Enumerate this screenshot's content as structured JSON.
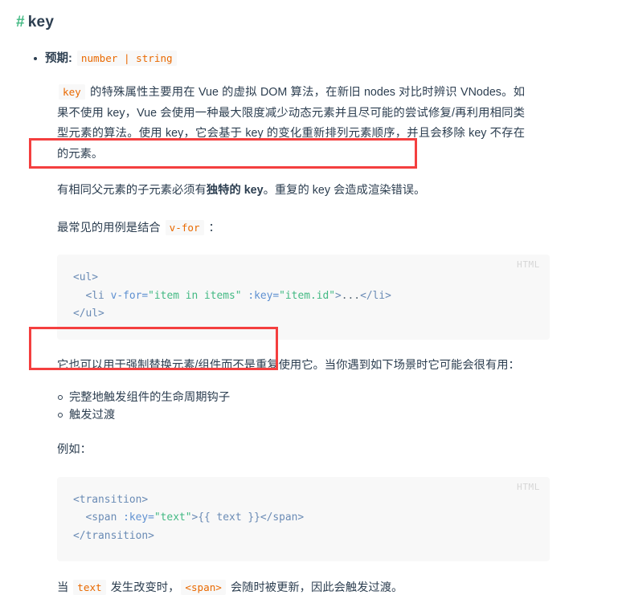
{
  "heading": {
    "anchor": "#",
    "title": "key"
  },
  "expects": {
    "label": "预期:",
    "types": "number | string"
  },
  "intro": {
    "code_key": "key",
    "text": " 的特殊属性主要用在 Vue 的虚拟 DOM 算法，在新旧 nodes 对比时辨识 VNodes。如果不使用 key，Vue 会使用一种最大限度减少动态元素并且尽可能的尝试修复/再利用相同类型元素的算法。使用 key，它会基于 key 的变化重新排列元素顺序，并且会移除 key 不存在的元素。"
  },
  "highlight_note": {
    "part1": "有相同父元素的子元素必须有",
    "bold": "独特的 key",
    "part2": "。重复的 key 会造成渲染错误。"
  },
  "usage_line": {
    "prefix": "最常见的用例是结合 ",
    "code": "v-for",
    "suffix": " ："
  },
  "code_block_1": {
    "lang": "HTML",
    "lines": [
      {
        "tokens": [
          {
            "t": "<ul>",
            "c": "tok-tag"
          }
        ]
      },
      {
        "tokens": [
          {
            "t": "  <li ",
            "c": "tok-tag"
          },
          {
            "t": "v-for=",
            "c": "tok-attr"
          },
          {
            "t": "\"item in items\"",
            "c": "tok-str"
          },
          {
            "t": " :key=",
            "c": "tok-attr"
          },
          {
            "t": "\"item.id\"",
            "c": "tok-str"
          },
          {
            "t": ">",
            "c": "tok-tag"
          },
          {
            "t": "...",
            "c": "tok-plain"
          },
          {
            "t": "</li>",
            "c": "tok-tag"
          }
        ]
      },
      {
        "tokens": [
          {
            "t": "</ul>",
            "c": "tok-tag"
          }
        ]
      }
    ]
  },
  "replace_note": "它也可以用于强制替换元素/组件而不是重复使用它。当你遇到如下场景时它可能会很有用：",
  "scenarios": [
    "完整地触发组件的生命周期钩子",
    "触发过渡"
  ],
  "example_label": "例如：",
  "code_block_2": {
    "lang": "HTML",
    "lines": [
      {
        "tokens": [
          {
            "t": "<transition>",
            "c": "tok-tag"
          }
        ]
      },
      {
        "tokens": [
          {
            "t": "  <span ",
            "c": "tok-tag"
          },
          {
            "t": ":key=",
            "c": "tok-attr"
          },
          {
            "t": "\"text\"",
            "c": "tok-str"
          },
          {
            "t": ">",
            "c": "tok-tag"
          },
          {
            "t": "{{ text }}",
            "c": "tok-punc"
          },
          {
            "t": "</span>",
            "c": "tok-tag"
          }
        ]
      },
      {
        "tokens": [
          {
            "t": "</transition>",
            "c": "tok-tag"
          }
        ]
      }
    ]
  },
  "closing": {
    "p1": "当 ",
    "code1": "text",
    "p2": " 发生改变时，",
    "code2": "<span>",
    "p3": " 会随时被更新，因此会触发过渡。"
  },
  "colors": {
    "accent_green": "#42b983",
    "inline_code": "#e96900",
    "annotation_red": "#f43f3f",
    "text": "#2c3e50",
    "code_bg": "#f8f8f8"
  }
}
